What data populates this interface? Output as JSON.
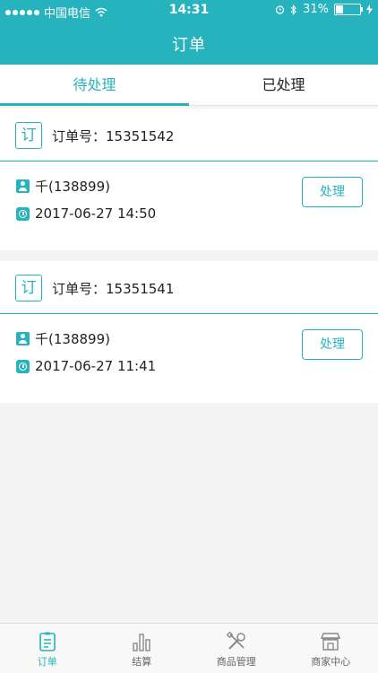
{
  "status_bar": {
    "carrier": "中国电信",
    "time": "14:31",
    "battery": "31%",
    "battery_level": 0.31
  },
  "nav": {
    "title": "订单"
  },
  "tabs": [
    {
      "label": "待处理",
      "active": true
    },
    {
      "label": "已处理",
      "active": false
    }
  ],
  "order_label": "订单号：",
  "orders": [
    {
      "badge": "订",
      "number": "15351542",
      "user": "千(138899)",
      "datetime": "2017-06-27 14:50",
      "action": "处理"
    },
    {
      "badge": "订",
      "number": "15351541",
      "user": "千(138899)",
      "datetime": "2017-06-27 11:41",
      "action": "处理"
    }
  ],
  "tabbar": [
    {
      "label": "订单",
      "icon": "clipboard-icon",
      "active": true
    },
    {
      "label": "结算",
      "icon": "bar-chart-icon",
      "active": false
    },
    {
      "label": "商品管理",
      "icon": "tools-icon",
      "active": false
    },
    {
      "label": "商家中心",
      "icon": "store-icon",
      "active": false
    }
  ],
  "colors": {
    "accent": "#27b3bd"
  }
}
